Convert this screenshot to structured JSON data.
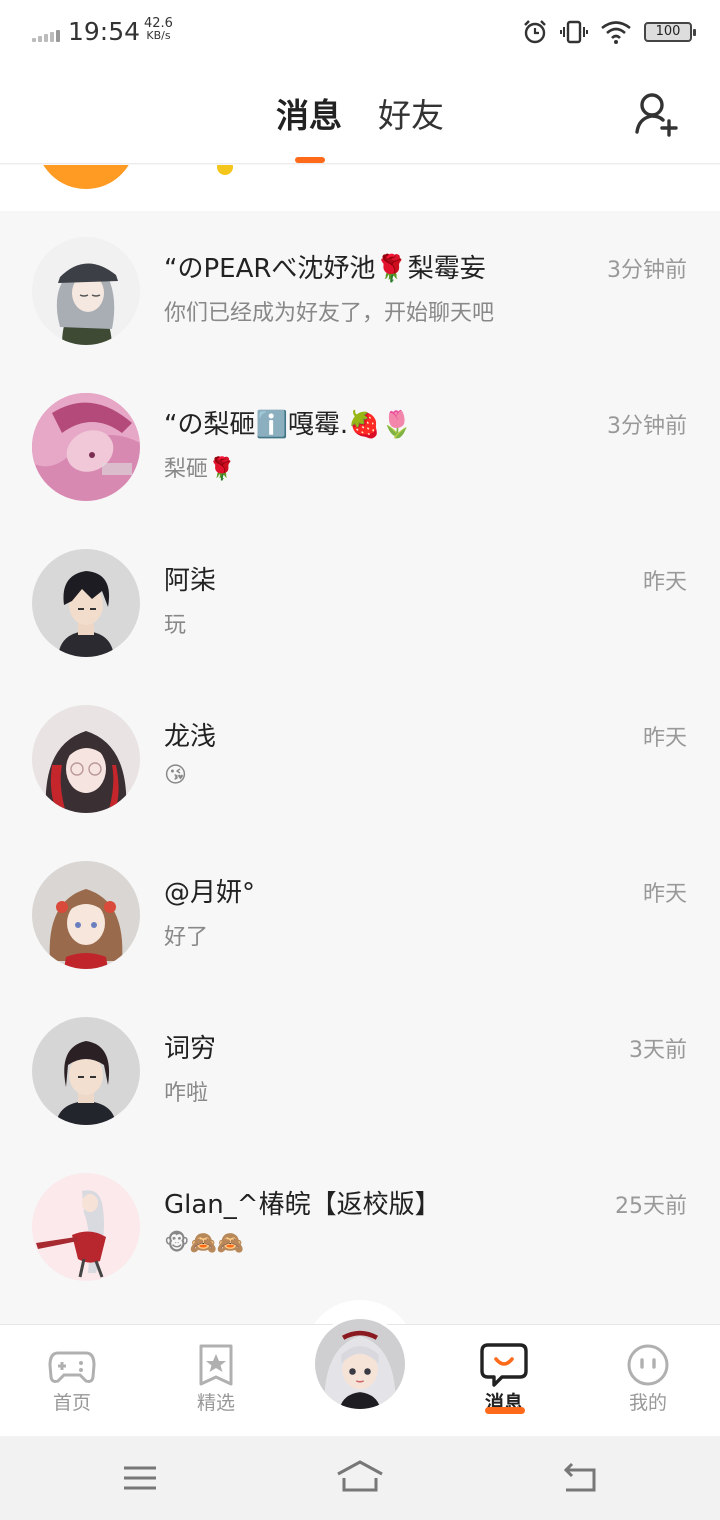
{
  "status_bar": {
    "time": "19:54",
    "net_speed_value": "42.6",
    "net_speed_unit": "KB/s",
    "battery": "100",
    "icons": [
      "signal-icon",
      "alarm-icon",
      "vibrate-icon",
      "wifi-icon",
      "battery-icon"
    ]
  },
  "header": {
    "tabs": [
      {
        "label": "消息",
        "active": true
      },
      {
        "label": "好友",
        "active": false
      }
    ],
    "add_friend_icon": "add-user-icon",
    "accent_color": "#ff6a1a"
  },
  "conversations": [
    {
      "name": "“のPEARべ沈妤池🌹梨霉妄",
      "preview": "你们已经成为好友了，开始聊天吧",
      "time": "3分钟前"
    },
    {
      "name": "“の梨砸ℹ️嘎霉.🍓🌷",
      "preview": "梨砸🌹",
      "time": "3分钟前"
    },
    {
      "name": "阿柒",
      "preview": "玩",
      "time": "昨天"
    },
    {
      "name": "龙浅",
      "preview": "😘",
      "time": "昨天"
    },
    {
      "name": "@月妍°",
      "preview": "好了",
      "time": "昨天"
    },
    {
      "name": "词穷",
      "preview": "咋啦",
      "time": "3天前"
    },
    {
      "name": "Glan_^椿皖【返校版】",
      "preview": "🐵🙈🙈",
      "time": "25天前"
    }
  ],
  "bottom_nav": {
    "items": [
      {
        "label": "首页",
        "icon": "gamepad-icon"
      },
      {
        "label": "精选",
        "icon": "star-bookmark-icon"
      },
      {
        "label": "消息",
        "icon": "message-bubble-icon",
        "active": true
      },
      {
        "label": "我的",
        "icon": "face-icon"
      }
    ]
  },
  "system_nav": [
    "menu-icon",
    "home-icon",
    "back-icon"
  ]
}
